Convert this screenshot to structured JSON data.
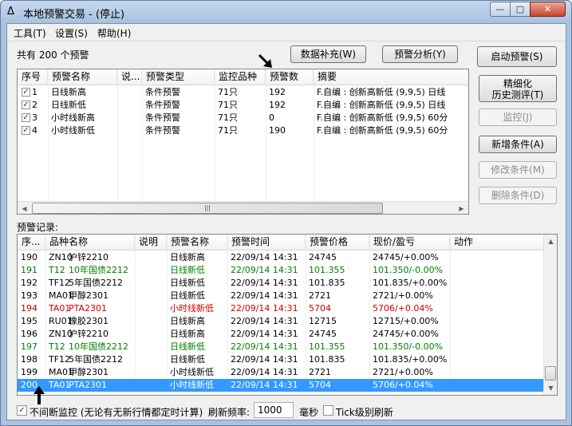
{
  "window": {
    "title": "本地预警交易 - (停止)"
  },
  "menu": [
    "工具(T)",
    "设置(S)",
    "帮助(H)"
  ],
  "top": {
    "count_label": "共有 200 个预警",
    "data_fill_button": "数据补充(W)",
    "analysis_button": "预警分析(Y)"
  },
  "side_buttons": {
    "start": "启动预警(S)",
    "refine_line1": "精细化",
    "refine_line2": "历史测评(T)",
    "monitor": "监控(J)",
    "add": "新增条件(A)",
    "modify": "修改条件(M)",
    "delete": "删除条件(D)"
  },
  "alerts": {
    "headers": [
      "序号",
      "预警名称",
      "说...",
      "预警类型",
      "监控品种",
      "预警数",
      "摘要"
    ],
    "rows": [
      {
        "no": "1",
        "name": "日线新高",
        "note": "",
        "type": "条件预警",
        "instruments": "71只",
        "count": "192",
        "summary": "F.自编 : 创新高新低 (9,9,5) 日线",
        "checked": true
      },
      {
        "no": "2",
        "name": "日线新低",
        "note": "",
        "type": "条件预警",
        "instruments": "71只",
        "count": "192",
        "summary": "F.自编 : 创新高新低 (9,9,5) 日线",
        "checked": true
      },
      {
        "no": "3",
        "name": "小时线新高",
        "note": "",
        "type": "条件预警",
        "instruments": "71只",
        "count": "0",
        "summary": "F.自编 : 创新高新低 (9,9,5) 60分",
        "checked": true
      },
      {
        "no": "4",
        "name": "小时线新低",
        "note": "",
        "type": "条件预警",
        "instruments": "71只",
        "count": "190",
        "summary": "F.自编 : 创新高新低 (9,9,5) 60分",
        "checked": true
      }
    ]
  },
  "records": {
    "label": "预警记录:",
    "headers": [
      "序...",
      "品种名称",
      "说明",
      "预警名称",
      "预警时间",
      "预警价格",
      "现价/盈亏",
      "动作"
    ],
    "rows": [
      {
        "no": "190",
        "code": "ZN10",
        "product": "沪锌2210",
        "note": "",
        "alert": "日线新高",
        "time": "22/09/14 14:31",
        "price": "24745",
        "pnl": "24745/+0.00%",
        "action": "",
        "color": "#000000"
      },
      {
        "no": "191",
        "code": "T12",
        "product": "10年国债2212",
        "note": "",
        "alert": "日线新低",
        "time": "22/09/14 14:31",
        "price": "101.355",
        "pnl": "101.350/-0.00%",
        "action": "",
        "color": "#008000"
      },
      {
        "no": "192",
        "code": "TF12",
        "product": "5年国债2212",
        "note": "",
        "alert": "日线新低",
        "time": "22/09/14 14:31",
        "price": "101.835",
        "pnl": "101.835/+0.00%",
        "action": "",
        "color": "#000000"
      },
      {
        "no": "193",
        "code": "MA01",
        "product": "甲醇2301",
        "note": "",
        "alert": "日线新低",
        "time": "22/09/14 14:31",
        "price": "2721",
        "pnl": "2721/+0.00%",
        "action": "",
        "color": "#000000"
      },
      {
        "no": "194",
        "code": "TA01",
        "product": "PTA2301",
        "note": "",
        "alert": "小时线新低",
        "time": "22/09/14 14:31",
        "price": "5704",
        "pnl": "5706/+0.04%",
        "action": "",
        "color": "#cc0000"
      },
      {
        "no": "195",
        "code": "RU01",
        "product": "橡胶2301",
        "note": "",
        "alert": "日线新高",
        "time": "22/09/14 14:31",
        "price": "12715",
        "pnl": "12715/+0.00%",
        "action": "",
        "color": "#000000"
      },
      {
        "no": "196",
        "code": "ZN10",
        "product": "沪锌2210",
        "note": "",
        "alert": "日线新高",
        "time": "22/09/14 14:31",
        "price": "24745",
        "pnl": "24745/+0.00%",
        "action": "",
        "color": "#000000"
      },
      {
        "no": "197",
        "code": "T12",
        "product": "10年国债2212",
        "note": "",
        "alert": "日线新低",
        "time": "22/09/14 14:31",
        "price": "101.355",
        "pnl": "101.350/-0.00%",
        "action": "",
        "color": "#008000"
      },
      {
        "no": "198",
        "code": "TF12",
        "product": "5年国债2212",
        "note": "",
        "alert": "日线新低",
        "time": "22/09/14 14:31",
        "price": "101.835",
        "pnl": "101.835/+0.00%",
        "action": "",
        "color": "#000000"
      },
      {
        "no": "199",
        "code": "MA01",
        "product": "甲醇2301",
        "note": "",
        "alert": "小时线新低",
        "time": "22/09/14 14:31",
        "price": "2721",
        "pnl": "2721/+0.00%",
        "action": "",
        "color": "#000000"
      },
      {
        "no": "200",
        "code": "TA01",
        "product": "PTA2301",
        "note": "",
        "alert": "小时线新低",
        "time": "22/09/14 14:31",
        "price": "5704",
        "pnl": "5706/+0.04%",
        "action": "",
        "color": "#ffffff",
        "selected": true
      }
    ]
  },
  "bottom": {
    "continuous_label": "不间断监控 (无论有无新行情都定时计算)",
    "continuous_checked": true,
    "refresh_label": "刷新频率:",
    "refresh_value": "1000",
    "unit": "毫秒",
    "tick_label": "Tick级别刷新",
    "tick_checked": false
  }
}
